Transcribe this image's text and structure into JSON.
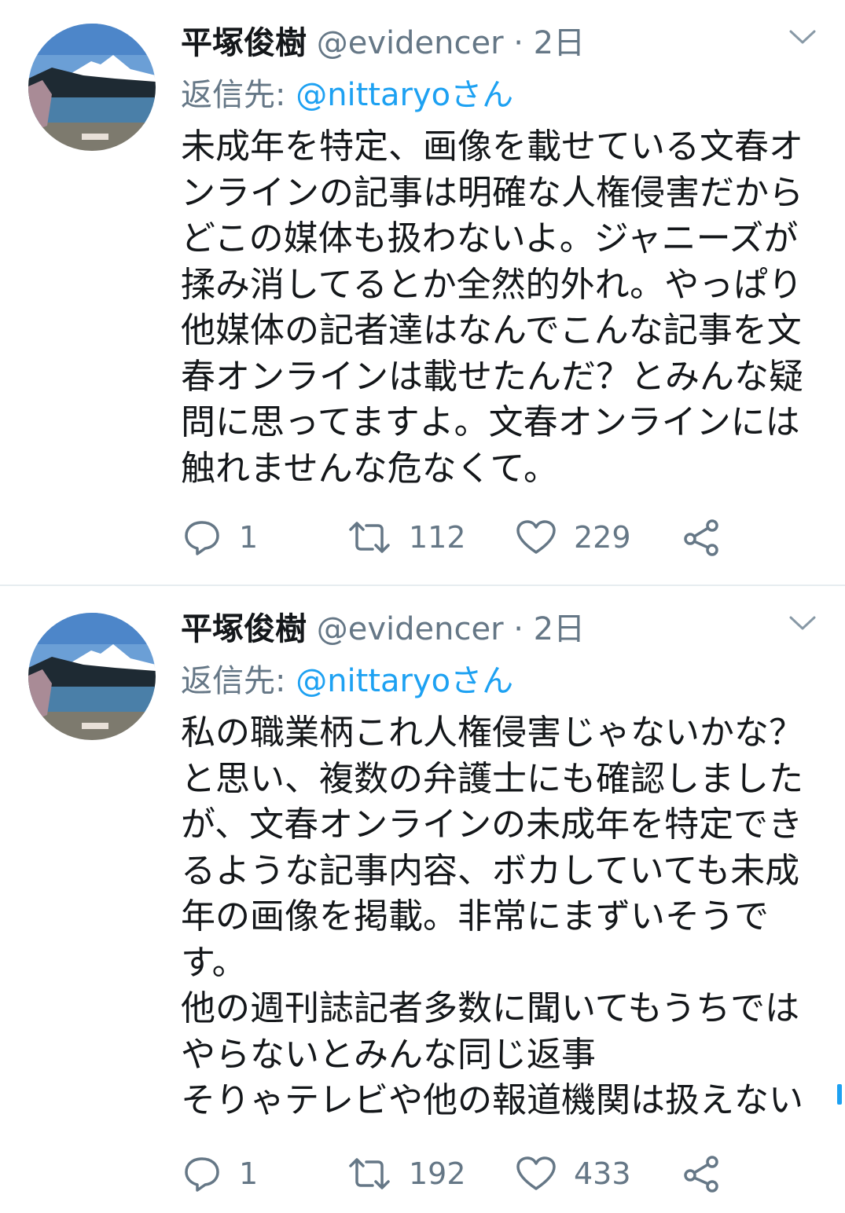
{
  "colors": {
    "text": "#14171a",
    "secondary": "#657786",
    "accent": "#1da1f2",
    "divider": "#e6ecf0"
  },
  "tweets": [
    {
      "display_name": "平塚俊樹",
      "handle": "@evidencer",
      "separator": "·",
      "time": "2日",
      "reply_prefix": "返信先: ",
      "reply_mention": "@nittaryo",
      "reply_suffix": "さん",
      "body_lines": [
        "未成年を特定、画像を載せている文春オ",
        "ンラインの記事は明確な人権侵害だから",
        "どこの媒体も扱わないよ。ジャニーズが",
        "揉み消してるとか全然的外れ。やっぱり",
        "他媒体の記者達はなんでこんな記事を文",
        "春オンラインは載せたんだ？とみんな疑",
        "問に思ってますよ。文春オンラインには",
        "触れませんな危なくて。"
      ],
      "replies": "1",
      "retweets": "112",
      "likes": "229",
      "avatar_icon": "avatar-lake-mountain-photo"
    },
    {
      "display_name": "平塚俊樹",
      "handle": "@evidencer",
      "separator": "·",
      "time": "2日",
      "reply_prefix": "返信先: ",
      "reply_mention": "@nittaryo",
      "reply_suffix": "さん",
      "body_lines": [
        "私の職業柄これ人権侵害じゃないかな？",
        "と思い、複数の弁護士にも確認しました",
        "が、文春オンラインの未成年を特定でき",
        "るような記事内容、ボカしていても未成",
        "年の画像を掲載。非常にまずいそうで",
        "す。",
        "他の週刊誌記者多数に聞いてもうちでは",
        "やらないとみんな同じ返事",
        "そりゃテレビや他の報道機関は扱えない"
      ],
      "replies": "1",
      "retweets": "192",
      "likes": "433",
      "avatar_icon": "avatar-lake-mountain-photo"
    }
  ]
}
